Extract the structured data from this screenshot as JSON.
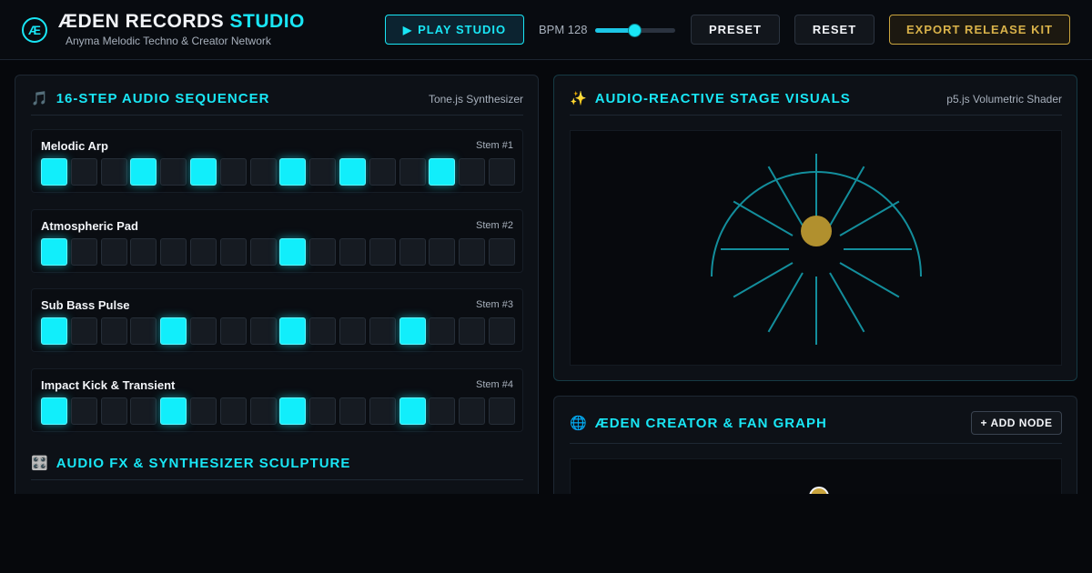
{
  "header": {
    "logo_text": "Æ",
    "title_white": "ÆDEN RECORDS",
    "title_cyan": "STUDIO",
    "subtitle": "Anyma Melodic Techno & Creator Network",
    "play_icon": "▶",
    "play_label": "PLAY STUDIO",
    "bpm_label": "BPM 128",
    "bpm_value": 128,
    "bpm_min": 60,
    "bpm_max": 200,
    "preset_label": "PRESET",
    "reset_label": "RESET",
    "export_label": "EXPORT RELEASE KIT"
  },
  "sequencer": {
    "icon": "🎵",
    "title": "16-STEP AUDIO SEQUENCER",
    "meta": "Tone.js Synthesizer",
    "tracks": [
      {
        "name": "Melodic Arp",
        "stem": "Stem #1",
        "steps": [
          1,
          0,
          0,
          1,
          0,
          1,
          0,
          0,
          1,
          0,
          1,
          0,
          0,
          1,
          0,
          0
        ]
      },
      {
        "name": "Atmospheric Pad",
        "stem": "Stem #2",
        "steps": [
          1,
          0,
          0,
          0,
          0,
          0,
          0,
          0,
          1,
          0,
          0,
          0,
          0,
          0,
          0,
          0
        ]
      },
      {
        "name": "Sub Bass Pulse",
        "stem": "Stem #3",
        "steps": [
          1,
          0,
          0,
          0,
          1,
          0,
          0,
          0,
          1,
          0,
          0,
          0,
          1,
          0,
          0,
          0
        ]
      },
      {
        "name": "Impact Kick & Transient",
        "stem": "Stem #4",
        "steps": [
          1,
          0,
          0,
          0,
          1,
          0,
          0,
          0,
          1,
          0,
          0,
          0,
          1,
          0,
          0,
          0
        ]
      }
    ],
    "fx_icon": "🎛️",
    "fx_title": "AUDIO FX & SYNTHESIZER SCULPTURE"
  },
  "visuals": {
    "icon": "✨",
    "title": "AUDIO-REACTIVE STAGE VISUALS",
    "meta": "p5.js Volumetric Shader"
  },
  "graph": {
    "icon": "🌐",
    "title": "ÆDEN CREATOR & FAN GRAPH",
    "add_node_label": "+ ADD NODE"
  },
  "colors": {
    "accent": "#19e6f5",
    "gold": "#c9a43e",
    "background": "#06080c"
  }
}
